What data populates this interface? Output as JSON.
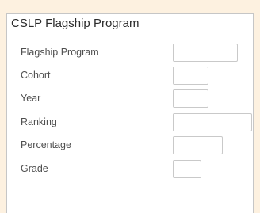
{
  "panel": {
    "title": "CSLP Flagship Program"
  },
  "fields": [
    {
      "label": "Flagship Program",
      "value": ""
    },
    {
      "label": "Cohort",
      "value": ""
    },
    {
      "label": "Year",
      "value": ""
    },
    {
      "label": "Ranking",
      "value": ""
    },
    {
      "label": "Percentage",
      "value": ""
    },
    {
      "label": "Grade",
      "value": ""
    }
  ],
  "colors": {
    "page_background": "#fdf1e0",
    "panel_background": "#ffffff",
    "border": "#c9c9c9"
  }
}
